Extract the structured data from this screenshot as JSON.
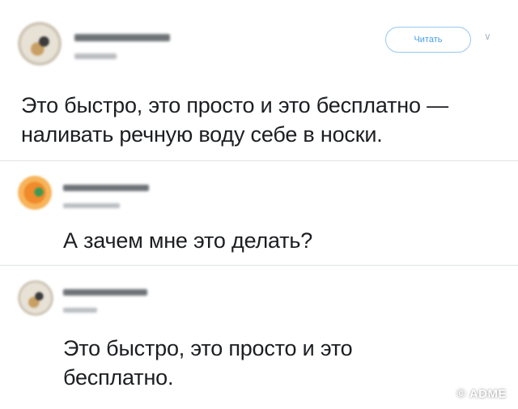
{
  "tweets": [
    {
      "text": "Это быстро, это просто и это бесплатно —\nналивать речную воду себе в носки.",
      "follow_label": "Читать",
      "menu_icon": "chevron-down-icon",
      "avatar_icon": "bird-avatar"
    },
    {
      "text": "А зачем мне это делать?",
      "avatar_icon": "pin-avatar"
    },
    {
      "text": "Это быстро, это просто и это\nбесплатно.",
      "avatar_icon": "bird-avatar"
    }
  ],
  "watermark": "© ADME",
  "colors": {
    "accent": "#1da1f2",
    "divider": "#e1e8ed",
    "text": "#14171a"
  }
}
